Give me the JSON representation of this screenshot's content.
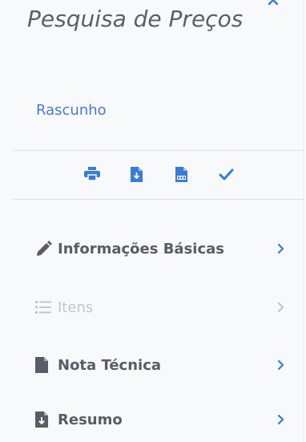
{
  "header": {
    "title": "Pesquisa de Preços",
    "status": "Rascunho"
  },
  "toolbar": {
    "actions": [
      {
        "name": "print",
        "icon": "print-icon"
      },
      {
        "name": "download",
        "icon": "file-download-icon"
      },
      {
        "name": "csv",
        "icon": "file-csv-icon"
      },
      {
        "name": "confirm",
        "icon": "check-icon"
      }
    ]
  },
  "menu": {
    "items": [
      {
        "label": "Informações Básicas",
        "icon": "pencil-icon",
        "enabled": true
      },
      {
        "label": "Itens",
        "icon": "list-icon",
        "enabled": false
      },
      {
        "label": "Nota Técnica",
        "icon": "file-icon",
        "enabled": true
      },
      {
        "label": "Resumo",
        "icon": "file-download-icon",
        "enabled": true
      }
    ]
  },
  "colors": {
    "accent": "#3b7bd4",
    "text": "#575d66",
    "disabled": "#c2c6cc",
    "panel_bg": "#f8f9fb"
  }
}
